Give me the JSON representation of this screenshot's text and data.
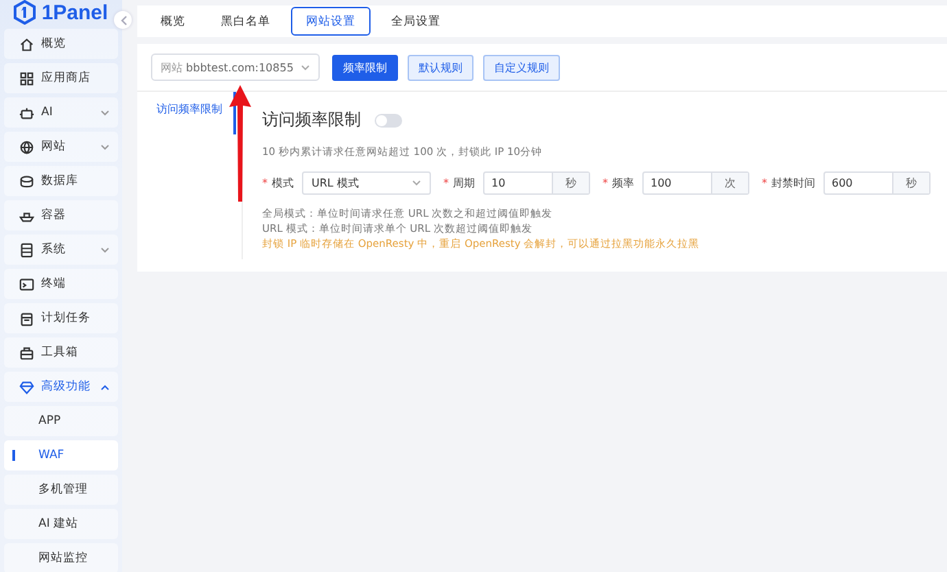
{
  "logo": {
    "text": "1Panel"
  },
  "sidebar": {
    "items": [
      {
        "label": "概览"
      },
      {
        "label": "应用商店"
      },
      {
        "label": "AI",
        "expanded": false
      },
      {
        "label": "网站",
        "expanded": false
      },
      {
        "label": "数据库"
      },
      {
        "label": "容器"
      },
      {
        "label": "系统",
        "expanded": false
      },
      {
        "label": "终端"
      },
      {
        "label": "计划任务"
      },
      {
        "label": "工具箱"
      },
      {
        "label": "高级功能",
        "expanded": true,
        "children": [
          {
            "label": "APP",
            "selected": false
          },
          {
            "label": "WAF",
            "selected": true
          },
          {
            "label": "多机管理",
            "selected": false
          },
          {
            "label": "AI 建站",
            "selected": false
          },
          {
            "label": "网站监控",
            "selected": false
          }
        ]
      }
    ]
  },
  "tabs": [
    {
      "label": "概览",
      "selected": false
    },
    {
      "label": "黑白名单",
      "selected": false
    },
    {
      "label": "网站设置",
      "selected": true
    },
    {
      "label": "全局设置",
      "selected": false
    }
  ],
  "site_select": {
    "prefix": "网站",
    "value": "bbbtest.com:10855"
  },
  "rule_buttons": [
    {
      "label": "频率限制",
      "selected": true
    },
    {
      "label": "默认规则",
      "selected": false
    },
    {
      "label": "自定义规则",
      "selected": false
    }
  ],
  "subnav": [
    {
      "label": "访问频率限制",
      "selected": true
    }
  ],
  "panel": {
    "title": "访问频率限制",
    "on": false,
    "description": "10 秒内累计请求任意网站超过 100 次，封锁此 IP 10分钟",
    "fields": [
      {
        "mark": "*",
        "label": "模式",
        "kind": "select",
        "value": "URL 模式"
      },
      {
        "mark": "*",
        "label": "周期",
        "kind": "input",
        "value": "10",
        "unit": "秒"
      },
      {
        "mark": "*",
        "label": "频率",
        "kind": "input",
        "value": "100",
        "unit": "次"
      },
      {
        "mark": "*",
        "label": "封禁时间",
        "kind": "input",
        "value": "600",
        "unit": "秒"
      }
    ],
    "notes": [
      {
        "text": "全局模式：单位时间请求任意 URL 次数之和超过阈值即触发",
        "kind": "info"
      },
      {
        "text": "URL 模式：单位时间请求单个 URL 次数超过阈值即触发",
        "kind": "info"
      },
      {
        "text": "封锁 IP 临时存储在 OpenResty 中，重启 OpenResty 会解封，可以通过拉黑功能永久拉黑",
        "kind": "warning"
      }
    ]
  }
}
